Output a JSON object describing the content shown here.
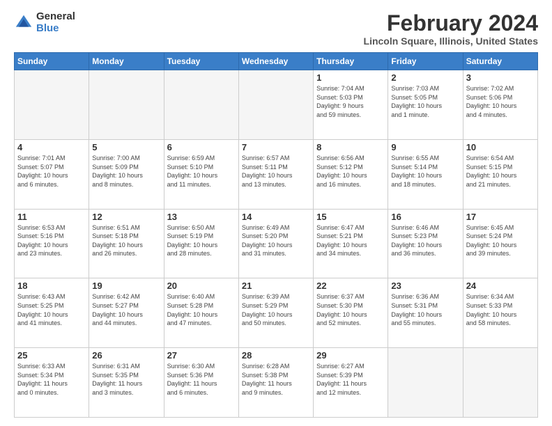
{
  "logo": {
    "general": "General",
    "blue": "Blue"
  },
  "header": {
    "title": "February 2024",
    "subtitle": "Lincoln Square, Illinois, United States"
  },
  "weekdays": [
    "Sunday",
    "Monday",
    "Tuesday",
    "Wednesday",
    "Thursday",
    "Friday",
    "Saturday"
  ],
  "weeks": [
    [
      {
        "day": "",
        "info": ""
      },
      {
        "day": "",
        "info": ""
      },
      {
        "day": "",
        "info": ""
      },
      {
        "day": "",
        "info": ""
      },
      {
        "day": "1",
        "info": "Sunrise: 7:04 AM\nSunset: 5:03 PM\nDaylight: 9 hours\nand 59 minutes."
      },
      {
        "day": "2",
        "info": "Sunrise: 7:03 AM\nSunset: 5:05 PM\nDaylight: 10 hours\nand 1 minute."
      },
      {
        "day": "3",
        "info": "Sunrise: 7:02 AM\nSunset: 5:06 PM\nDaylight: 10 hours\nand 4 minutes."
      }
    ],
    [
      {
        "day": "4",
        "info": "Sunrise: 7:01 AM\nSunset: 5:07 PM\nDaylight: 10 hours\nand 6 minutes."
      },
      {
        "day": "5",
        "info": "Sunrise: 7:00 AM\nSunset: 5:09 PM\nDaylight: 10 hours\nand 8 minutes."
      },
      {
        "day": "6",
        "info": "Sunrise: 6:59 AM\nSunset: 5:10 PM\nDaylight: 10 hours\nand 11 minutes."
      },
      {
        "day": "7",
        "info": "Sunrise: 6:57 AM\nSunset: 5:11 PM\nDaylight: 10 hours\nand 13 minutes."
      },
      {
        "day": "8",
        "info": "Sunrise: 6:56 AM\nSunset: 5:12 PM\nDaylight: 10 hours\nand 16 minutes."
      },
      {
        "day": "9",
        "info": "Sunrise: 6:55 AM\nSunset: 5:14 PM\nDaylight: 10 hours\nand 18 minutes."
      },
      {
        "day": "10",
        "info": "Sunrise: 6:54 AM\nSunset: 5:15 PM\nDaylight: 10 hours\nand 21 minutes."
      }
    ],
    [
      {
        "day": "11",
        "info": "Sunrise: 6:53 AM\nSunset: 5:16 PM\nDaylight: 10 hours\nand 23 minutes."
      },
      {
        "day": "12",
        "info": "Sunrise: 6:51 AM\nSunset: 5:18 PM\nDaylight: 10 hours\nand 26 minutes."
      },
      {
        "day": "13",
        "info": "Sunrise: 6:50 AM\nSunset: 5:19 PM\nDaylight: 10 hours\nand 28 minutes."
      },
      {
        "day": "14",
        "info": "Sunrise: 6:49 AM\nSunset: 5:20 PM\nDaylight: 10 hours\nand 31 minutes."
      },
      {
        "day": "15",
        "info": "Sunrise: 6:47 AM\nSunset: 5:21 PM\nDaylight: 10 hours\nand 34 minutes."
      },
      {
        "day": "16",
        "info": "Sunrise: 6:46 AM\nSunset: 5:23 PM\nDaylight: 10 hours\nand 36 minutes."
      },
      {
        "day": "17",
        "info": "Sunrise: 6:45 AM\nSunset: 5:24 PM\nDaylight: 10 hours\nand 39 minutes."
      }
    ],
    [
      {
        "day": "18",
        "info": "Sunrise: 6:43 AM\nSunset: 5:25 PM\nDaylight: 10 hours\nand 41 minutes."
      },
      {
        "day": "19",
        "info": "Sunrise: 6:42 AM\nSunset: 5:27 PM\nDaylight: 10 hours\nand 44 minutes."
      },
      {
        "day": "20",
        "info": "Sunrise: 6:40 AM\nSunset: 5:28 PM\nDaylight: 10 hours\nand 47 minutes."
      },
      {
        "day": "21",
        "info": "Sunrise: 6:39 AM\nSunset: 5:29 PM\nDaylight: 10 hours\nand 50 minutes."
      },
      {
        "day": "22",
        "info": "Sunrise: 6:37 AM\nSunset: 5:30 PM\nDaylight: 10 hours\nand 52 minutes."
      },
      {
        "day": "23",
        "info": "Sunrise: 6:36 AM\nSunset: 5:31 PM\nDaylight: 10 hours\nand 55 minutes."
      },
      {
        "day": "24",
        "info": "Sunrise: 6:34 AM\nSunset: 5:33 PM\nDaylight: 10 hours\nand 58 minutes."
      }
    ],
    [
      {
        "day": "25",
        "info": "Sunrise: 6:33 AM\nSunset: 5:34 PM\nDaylight: 11 hours\nand 0 minutes."
      },
      {
        "day": "26",
        "info": "Sunrise: 6:31 AM\nSunset: 5:35 PM\nDaylight: 11 hours\nand 3 minutes."
      },
      {
        "day": "27",
        "info": "Sunrise: 6:30 AM\nSunset: 5:36 PM\nDaylight: 11 hours\nand 6 minutes."
      },
      {
        "day": "28",
        "info": "Sunrise: 6:28 AM\nSunset: 5:38 PM\nDaylight: 11 hours\nand 9 minutes."
      },
      {
        "day": "29",
        "info": "Sunrise: 6:27 AM\nSunset: 5:39 PM\nDaylight: 11 hours\nand 12 minutes."
      },
      {
        "day": "",
        "info": ""
      },
      {
        "day": "",
        "info": ""
      }
    ]
  ]
}
